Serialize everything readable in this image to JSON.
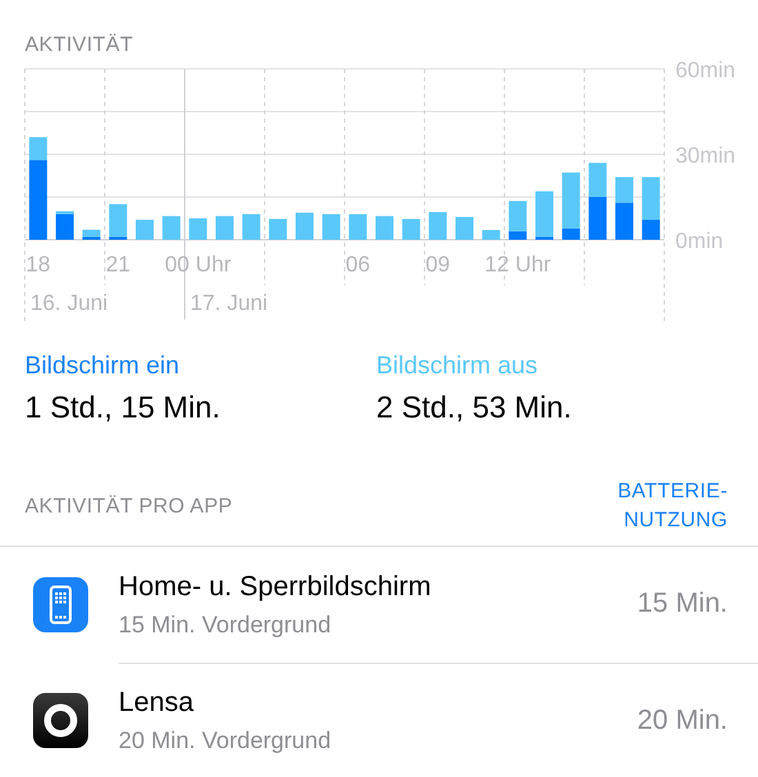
{
  "activity": {
    "title": "AKTIVITÄT",
    "chart_data": {
      "type": "bar",
      "stacked": true,
      "categories": [
        "18",
        null,
        null,
        "21",
        null,
        null,
        "00 Uhr",
        null,
        null,
        null,
        null,
        null,
        "06",
        null,
        null,
        "09",
        null,
        null,
        "12 Uhr",
        null,
        null,
        null,
        null,
        null
      ],
      "series": [
        {
          "color": "#007aff",
          "values": [
            28,
            9,
            1,
            1,
            0,
            0,
            0,
            0,
            0,
            0,
            0,
            0,
            0,
            0,
            0,
            0,
            0,
            0,
            3,
            1,
            4,
            15,
            13,
            7
          ]
        },
        {
          "color": "#5ac8fa",
          "values": [
            8,
            1,
            2.5,
            11.5,
            7,
            8.3,
            7.5,
            8.3,
            9,
            7.3,
            9.5,
            9,
            9,
            8.3,
            7.3,
            9.7,
            8,
            3.4,
            10.6,
            16,
            19.6,
            12,
            9,
            15
          ]
        }
      ],
      "ylim": [
        0,
        60
      ],
      "yticks": [
        {
          "value": 0,
          "label": "0min"
        },
        {
          "value": 30,
          "label": "30min"
        },
        {
          "value": 60,
          "label": "60min"
        }
      ],
      "annotations": [
        "16. Juni",
        "17. Juni"
      ]
    }
  },
  "summary": [
    {
      "label": "Bildschirm ein",
      "value": "1 Std., 15 Min.",
      "color": "#1a82f7"
    },
    {
      "label": "Bildschirm aus",
      "value": "2 Std., 53 Min.",
      "color": "#5ac8fa"
    }
  ],
  "per_app": {
    "title": "AKTIVITÄT PRO APP",
    "toggle": "BATTERIE-\nNUTZUNG",
    "apps": [
      {
        "kind": "system",
        "name": "Home- u. Sperrbildschirm",
        "detail": "15 Min. Vordergrund",
        "usage": "15 Min."
      },
      {
        "kind": "camera",
        "name": "Lensa",
        "detail": "20 Min. Vordergrund",
        "usage": "20 Min."
      }
    ]
  }
}
